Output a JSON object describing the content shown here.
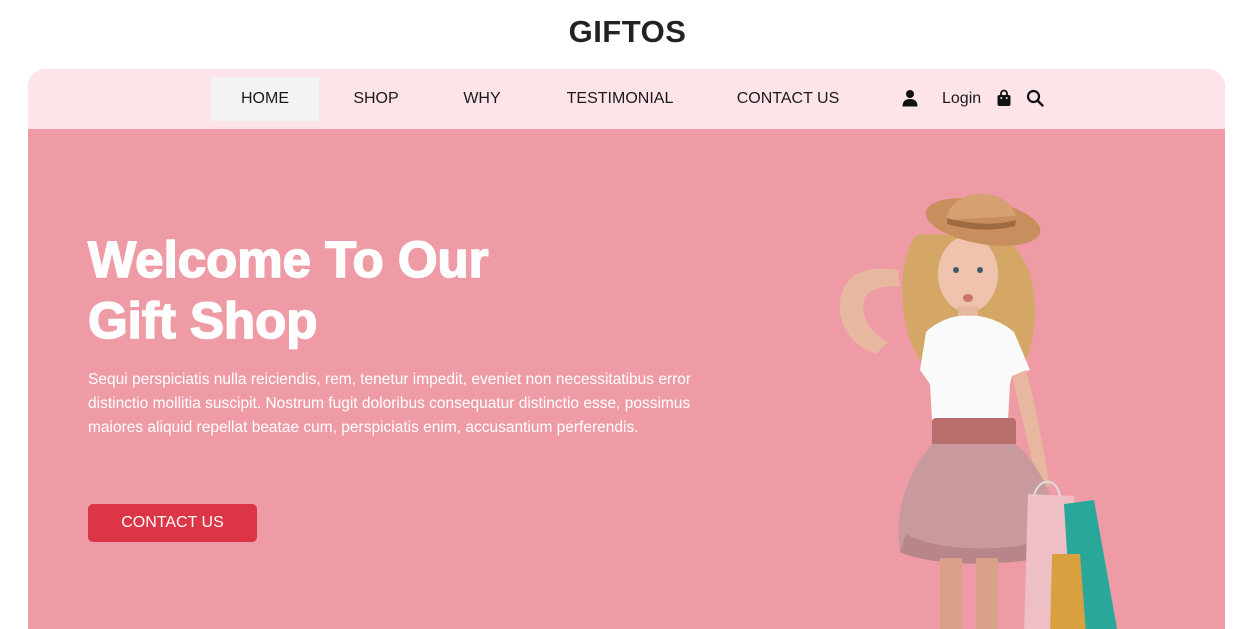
{
  "header": {
    "brand": "GIFTOS"
  },
  "nav": {
    "items": [
      {
        "label": "HOME",
        "active": true
      },
      {
        "label": "SHOP",
        "active": false
      },
      {
        "label": "WHY",
        "active": false
      },
      {
        "label": "TESTIMONIAL",
        "active": false
      },
      {
        "label": "CONTACT US",
        "active": false
      }
    ],
    "login_label": "Login",
    "icons": [
      "user-icon",
      "shopping-bag-icon",
      "search-icon"
    ]
  },
  "hero": {
    "title_line1": "Welcome To Our",
    "title_line2": "Gift Shop",
    "description": "Sequi perspiciatis nulla reiciendis, rem, tenetur impedit, eveniet non necessitatibus error distinctio mollitia suscipit. Nostrum fugit doloribus consequatur distinctio esse, possimus maiores aliquid repellat beatae cum, perspiciatis enim, accusantium perferendis.",
    "button_label": "CONTACT US",
    "image": "girl-with-shopping-bags"
  },
  "colors": {
    "hero_background": "#ee9ba6",
    "navbar_background": "#fde4e8",
    "active_nav_background": "#f3f3f3",
    "button": "#dc3545",
    "text_light": "#ffffff",
    "text_dark": "#1a1a1a"
  }
}
